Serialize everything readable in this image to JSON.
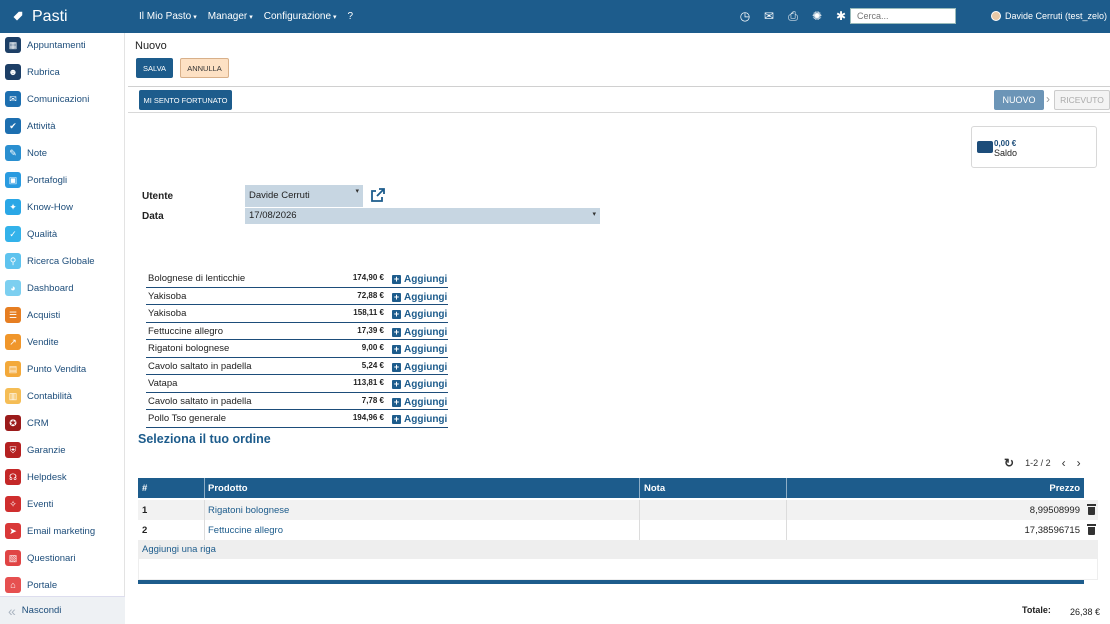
{
  "app": {
    "brand": "Pasti"
  },
  "topmenu": [
    {
      "label": "Il Mio Pasto",
      "has_caret": true
    },
    {
      "label": "Manager",
      "has_caret": true
    },
    {
      "label": "Configurazione",
      "has_caret": true
    },
    {
      "label": "?",
      "has_caret": false
    }
  ],
  "topicons": [
    "timer-icon",
    "chat-icon",
    "print-icon",
    "spinner-icon",
    "bug-icon"
  ],
  "search": {
    "placeholder": "Cerca..."
  },
  "user": {
    "name": "Davide Cerruti (test_zelo)"
  },
  "sidebar": {
    "items": [
      {
        "label": "Appuntamenti",
        "icon": "calendar-icon",
        "color": "#1d3f66",
        "glyph": "▦"
      },
      {
        "label": "Rubrica",
        "icon": "contacts-icon",
        "color": "#1d3f66",
        "glyph": "☻"
      },
      {
        "label": "Comunicazioni",
        "icon": "speech-icon",
        "color": "#1d6fb0",
        "glyph": "✉"
      },
      {
        "label": "Attività",
        "icon": "checkbox-icon",
        "color": "#1d6fb0",
        "glyph": "✔"
      },
      {
        "label": "Note",
        "icon": "notes-icon",
        "color": "#2a8fd0",
        "glyph": "✎"
      },
      {
        "label": "Portafogli",
        "icon": "wallet-icon",
        "color": "#2a9be0",
        "glyph": "▣"
      },
      {
        "label": "Know-How",
        "icon": "brain-icon",
        "color": "#2aa7e6",
        "glyph": "✦"
      },
      {
        "label": "Qualità",
        "icon": "quality-icon",
        "color": "#33b2ea",
        "glyph": "✓"
      },
      {
        "label": "Ricerca Globale",
        "icon": "magnifier-icon",
        "color": "#5ec3ee",
        "glyph": "⚲"
      },
      {
        "label": "Dashboard",
        "icon": "dashboard-icon",
        "color": "#7ccff0",
        "glyph": "◕"
      },
      {
        "label": "Acquisti",
        "icon": "cart-icon",
        "color": "#e67e22",
        "glyph": "☰"
      },
      {
        "label": "Vendite",
        "icon": "chart-line-icon",
        "color": "#f0962b",
        "glyph": "↗"
      },
      {
        "label": "Punto Vendita",
        "icon": "cashier-icon",
        "color": "#f3a93a",
        "glyph": "▤"
      },
      {
        "label": "Contabilità",
        "icon": "calculator-icon",
        "color": "#f5bd55",
        "glyph": "▥"
      },
      {
        "label": "CRM",
        "icon": "crm-icon",
        "color": "#9b1b1b",
        "glyph": "✪"
      },
      {
        "label": "Garanzie",
        "icon": "shield-icon",
        "color": "#b52121",
        "glyph": "⛨"
      },
      {
        "label": "Helpdesk",
        "icon": "headset-icon",
        "color": "#c42828",
        "glyph": "☊"
      },
      {
        "label": "Eventi",
        "icon": "ticket-icon",
        "color": "#cf2e2e",
        "glyph": "✧"
      },
      {
        "label": "Email marketing",
        "icon": "email-icon",
        "color": "#d93838",
        "glyph": "➤"
      },
      {
        "label": "Questionari",
        "icon": "survey-icon",
        "color": "#e04444",
        "glyph": "▧"
      },
      {
        "label": "Portale",
        "icon": "portal-icon",
        "color": "#e65050",
        "glyph": "⌂"
      }
    ],
    "hide_label": "Nascondi"
  },
  "page": {
    "title": "Nuovo",
    "save_label": "SALVA",
    "cancel_label": "ANNULLA",
    "lucky_label": "MI SENTO FORTUNATO",
    "status_new": "NUOVO",
    "status_received": "RICEVUTO"
  },
  "saldo": {
    "amount": "0,00 €",
    "label": "Saldo"
  },
  "form": {
    "utente_label": "Utente",
    "utente_value": "Davide Cerruti",
    "data_label": "Data",
    "data_value": "17/08/2026"
  },
  "products": [
    {
      "name": "Bolognese di lenticchie",
      "price": "174,90 €"
    },
    {
      "name": "Yakisoba",
      "price": "72,88 €"
    },
    {
      "name": "Yakisoba",
      "price": "158,11 €"
    },
    {
      "name": "Fettuccine allegro",
      "price": "17,39 €"
    },
    {
      "name": "Rigatoni bolognese",
      "price": "9,00 €"
    },
    {
      "name": "Cavolo saltato in padella",
      "price": "5,24 €"
    },
    {
      "name": "Vatapa",
      "price": "113,81 €"
    },
    {
      "name": "Cavolo saltato in padella",
      "price": "7,78 €"
    },
    {
      "name": "Pollo Tso generale",
      "price": "194,96 €"
    }
  ],
  "add_label": "Aggiungi",
  "order": {
    "title": "Seleziona il tuo ordine",
    "pager": "1-2 / 2",
    "columns": [
      "#",
      "Prodotto",
      "Nota",
      "Prezzo"
    ],
    "rows": [
      {
        "num": "1",
        "product": "Rigatoni bolognese",
        "note": "",
        "price": "8,99508999"
      },
      {
        "num": "2",
        "product": "Fettuccine allegro",
        "note": "",
        "price": "17,38596715"
      }
    ],
    "add_row_label": "Aggiungi una riga",
    "total_label": "Totale:",
    "total_value": "26,38 €"
  }
}
